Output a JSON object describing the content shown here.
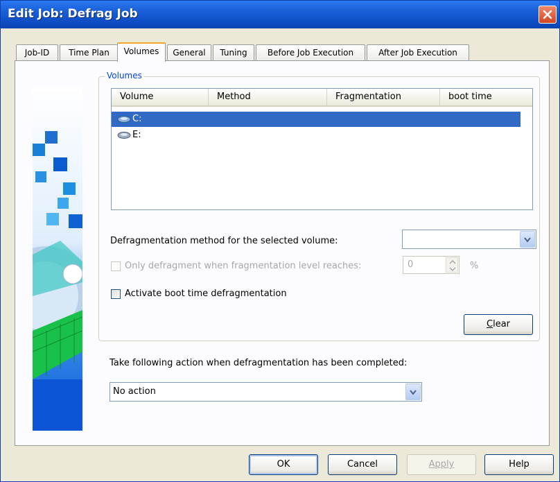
{
  "window": {
    "title": "Edit Job: Defrag Job"
  },
  "tabs": [
    {
      "label": "Job-ID"
    },
    {
      "label": "Time Plan"
    },
    {
      "label": "Volumes"
    },
    {
      "label": "General"
    },
    {
      "label": "Tuning"
    },
    {
      "label": "Before Job Execution"
    },
    {
      "label": "After Job Execution"
    }
  ],
  "active_tab": "Volumes",
  "volumes_group": {
    "label": "Volumes",
    "columns": [
      "Volume",
      "Method",
      "Fragmentation",
      "boot time"
    ],
    "rows": [
      {
        "volume": "C:",
        "selected": true
      },
      {
        "volume": "E:",
        "selected": false
      }
    ]
  },
  "method": {
    "label": "Defragmentation method for the selected volume:",
    "value": ""
  },
  "threshold": {
    "label": "Only defragment when fragmentation level reaches:",
    "value": "0",
    "unit": "%",
    "checked": false,
    "enabled": false
  },
  "boot_time": {
    "label": "Activate boot time defragmentation",
    "checked": false
  },
  "clear_button": {
    "label": "Clear",
    "accel": "C",
    "rest": "lear"
  },
  "completion_action": {
    "label": "Take following action when defragmentation has been completed:",
    "value": "No action"
  },
  "footer": {
    "ok": "OK",
    "cancel": "Cancel",
    "apply": "Apply",
    "help": "Help"
  },
  "colors": {
    "titlebar": "#0f4ec4",
    "selection": "#316ac5",
    "group_label": "#0046d5",
    "active_tab_accent": "#f5a623"
  }
}
